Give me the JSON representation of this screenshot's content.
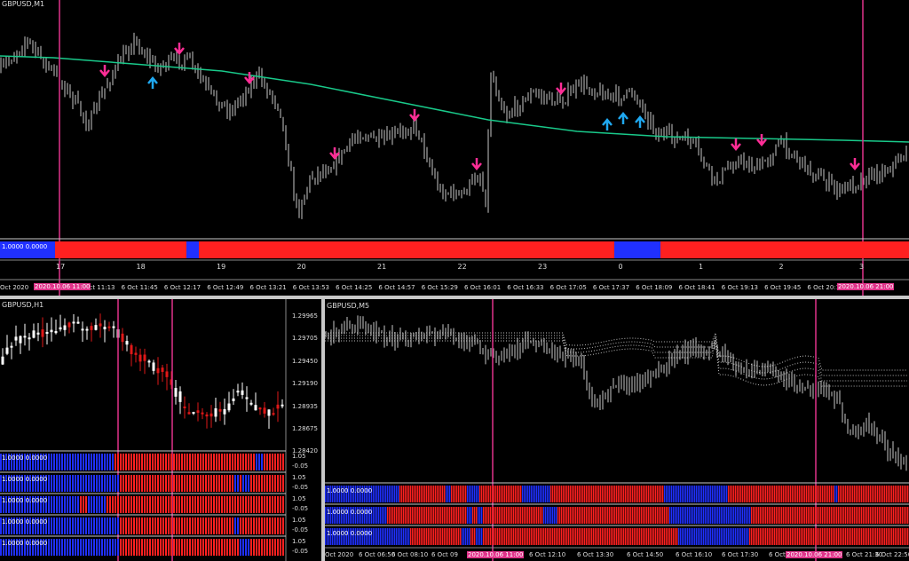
{
  "colors": {
    "bull": "#ff2020",
    "bear": "#2030ff",
    "ma": "#19c98a",
    "vline": "#e0338a",
    "arrow_down": "#ff2d96",
    "arrow_up": "#1fa8f0",
    "candle_up": "#ffffff",
    "candle_dn": "#e01818"
  },
  "top": {
    "title": "GBPUSD,M1",
    "indicator_label": "1.0000 0.0000",
    "counter_labels": [
      "17",
      "18",
      "19",
      "20",
      "21",
      "22",
      "23",
      "0",
      "1",
      "2",
      "3"
    ],
    "time_labels": [
      "Oct 2020",
      "6 Oct 11:13",
      "6 Oct 11:45",
      "6 Oct 12:17",
      "6 Oct 12:49",
      "6 Oct 13:21",
      "6 Oct 13:53",
      "6 Oct 14:25",
      "6 Oct 14:57",
      "6 Oct 15:29",
      "6 Oct 16:01",
      "6 Oct 16:33",
      "6 Oct 17:05",
      "6 Oct 17:37",
      "6 Oct 18:09",
      "6 Oct 18:41",
      "6 Oct 19:13",
      "6 Oct 19:45",
      "6 Oct 20:17",
      "6 Oct 2"
    ],
    "tag_left": "2020.10.06 11:00",
    "tag_right": "2020.10.06 21:00",
    "down_arrows": 4,
    "up_arrows": 4
  },
  "h1": {
    "title": "GBPUSD,H1",
    "prices": [
      "1.29965",
      "1.29705",
      "1.29450",
      "1.29190",
      "1.28935",
      "1.28675",
      "1.28420"
    ],
    "rows": [
      {
        "label": "1.0000 0.0000",
        "scale_hi": "1.05",
        "scale_lo": "-0.05"
      },
      {
        "label": "1.0000 0.0000",
        "scale_hi": "1.05",
        "scale_lo": "-0.05"
      },
      {
        "label": "1.0000 0.0000",
        "scale_hi": "1.05",
        "scale_lo": "-0.05"
      },
      {
        "label": "1.0000 0.0000",
        "scale_hi": "1.05",
        "scale_lo": "-0.05"
      },
      {
        "label": "1.0000 0.0000",
        "scale_hi": "1.05",
        "scale_lo": "-0.05"
      }
    ]
  },
  "m5": {
    "title": "GBPUSD,M5",
    "rows": [
      {
        "label": "1.0000 0.0000"
      },
      {
        "label": "1.0000 0.0000"
      },
      {
        "label": "1.0000 0.0000"
      }
    ],
    "time_labels": [
      "Oct 2020",
      "6 Oct 06:50",
      "6 Oct 08:10",
      "6 Oct 09",
      "6 Oct 12:10",
      "6 Oct 13:30",
      "6 Oct 14:50",
      "6 Oct 16:10",
      "6 Oct 17:30",
      "6 Oct 18:50",
      "6 Oct 21:30",
      "6 Oct 22:50"
    ],
    "tag_left": "2020.10.06 11:00",
    "tag_right": "2020.10.06 21:00"
  }
}
